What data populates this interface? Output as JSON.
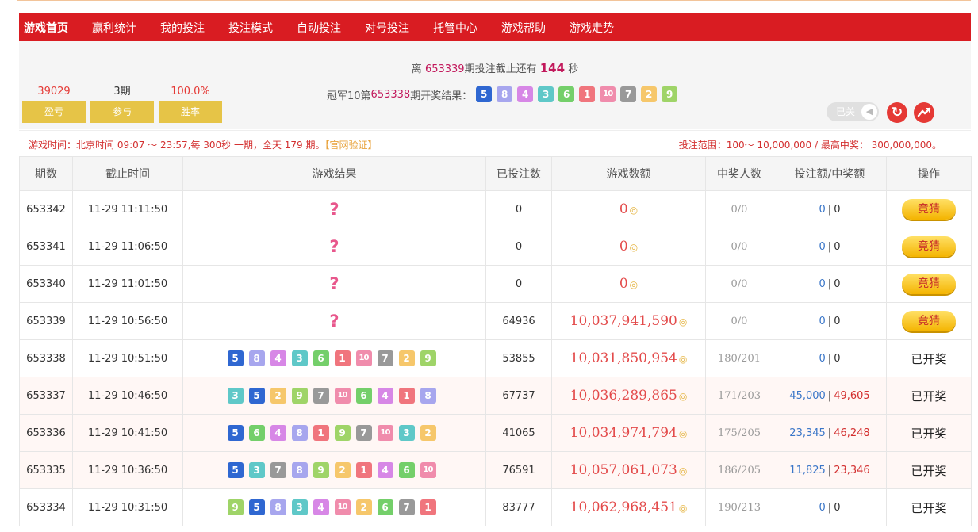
{
  "nav": {
    "items": [
      "游戏首页",
      "赢利统计",
      "我的投注",
      "投注模式",
      "自动投注",
      "对号投注",
      "托管中心",
      "游戏帮助",
      "游戏走势"
    ]
  },
  "countdown": {
    "prefix": "离",
    "issue": "653339",
    "mid": "期投注截止还有",
    "seconds": "144",
    "suffix": "秒"
  },
  "stats": [
    {
      "value": "39029",
      "label": "盈亏"
    },
    {
      "value": "3期",
      "label": "参与"
    },
    {
      "value": "100.0%",
      "label": "胜率"
    }
  ],
  "last_result": {
    "prefix": "冠军10第",
    "issue": "653338",
    "suffix": "期开奖结果：",
    "balls": [
      5,
      8,
      4,
      3,
      6,
      1,
      10,
      7,
      2,
      9
    ]
  },
  "sound_toggle": {
    "label": "已关"
  },
  "info": {
    "schedule": "游戏时间：北京时间 09:07 ～ 23:57,每 300秒 一期，全天 179 期。",
    "verify": "【官网验证】",
    "range": "投注范围：100～ 10,000,000 / 最高中奖： 300,000,000。"
  },
  "table": {
    "headers": [
      "期数",
      "截止时间",
      "游戏结果",
      "已投注数",
      "游戏数额",
      "中奖人数",
      "投注额/中奖额",
      "操作"
    ],
    "rows": [
      {
        "issue": "653342",
        "time": "11-29 11:11:50",
        "result": "?",
        "bets": "0",
        "amount": "0",
        "winners": "0/0",
        "bet": "0",
        "win": "0",
        "action": "竟猜"
      },
      {
        "issue": "653341",
        "time": "11-29 11:06:50",
        "result": "?",
        "bets": "0",
        "amount": "0",
        "winners": "0/0",
        "bet": "0",
        "win": "0",
        "action": "竟猜"
      },
      {
        "issue": "653340",
        "time": "11-29 11:01:50",
        "result": "?",
        "bets": "0",
        "amount": "0",
        "winners": "0/0",
        "bet": "0",
        "win": "0",
        "action": "竟猜"
      },
      {
        "issue": "653339",
        "time": "11-29 10:56:50",
        "result": "?",
        "bets": "64936",
        "amount": "10,037,941,590",
        "winners": "0/0",
        "bet": "0",
        "win": "0",
        "action": "竟猜"
      },
      {
        "issue": "653338",
        "time": "11-29 10:51:50",
        "balls": [
          5,
          8,
          4,
          3,
          6,
          1,
          10,
          7,
          2,
          9
        ],
        "bets": "53855",
        "amount": "10,031,850,954",
        "winners": "180/201",
        "bet": "0",
        "win": "0",
        "action": "已开奖"
      },
      {
        "issue": "653337",
        "time": "11-29 10:46:50",
        "balls": [
          3,
          5,
          2,
          9,
          7,
          10,
          6,
          4,
          1,
          8
        ],
        "bets": "67737",
        "amount": "10,036,289,865",
        "winners": "171/203",
        "bet": "45,000",
        "win": "49,605",
        "action": "已开奖"
      },
      {
        "issue": "653336",
        "time": "11-29 10:41:50",
        "balls": [
          5,
          6,
          4,
          8,
          1,
          9,
          7,
          10,
          3,
          2
        ],
        "bets": "41065",
        "amount": "10,034,974,794",
        "winners": "175/205",
        "bet": "23,345",
        "win": "46,248",
        "action": "已开奖"
      },
      {
        "issue": "653335",
        "time": "11-29 10:36:50",
        "balls": [
          5,
          3,
          7,
          8,
          9,
          2,
          1,
          4,
          6,
          10
        ],
        "bets": "76591",
        "amount": "10,057,061,073",
        "winners": "186/205",
        "bet": "11,825",
        "win": "23,346",
        "action": "已开奖"
      },
      {
        "issue": "653334",
        "time": "11-29 10:31:50",
        "balls": [
          9,
          5,
          8,
          3,
          4,
          10,
          2,
          6,
          7,
          1
        ],
        "bets": "83777",
        "amount": "10,062,968,451",
        "winners": "190/213",
        "bet": "0",
        "win": "0",
        "action": "已开奖"
      }
    ]
  },
  "colors": {
    "nav_bg": "#d91c22",
    "accent": "#e53935",
    "stat_label_bg": "#e6c447"
  },
  "icons": {
    "refresh": "refresh-icon",
    "trend": "trend-icon",
    "speaker": "speaker-icon",
    "coin": "coin-icon"
  }
}
